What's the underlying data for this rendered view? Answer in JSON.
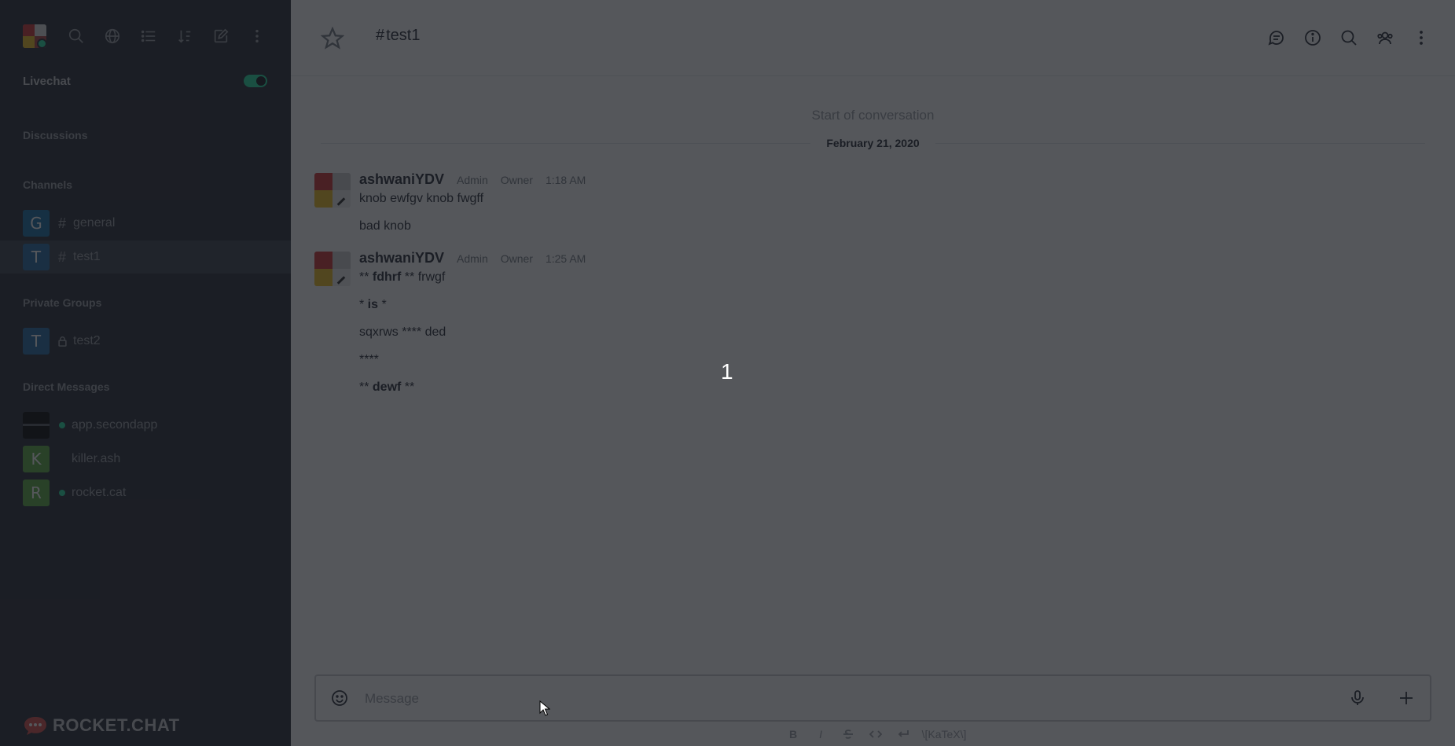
{
  "sidebar": {
    "livechat_label": "Livechat",
    "livechat_enabled": true,
    "sections": {
      "discussions": "Discussions",
      "channels": "Channels",
      "private_groups": "Private Groups",
      "direct_messages": "Direct Messages"
    },
    "channels": [
      {
        "initial": "G",
        "name": "general",
        "color": "#1d74a8"
      },
      {
        "initial": "T",
        "name": "test1",
        "color": "#2d6fa8"
      }
    ],
    "private_groups": [
      {
        "initial": "T",
        "name": "test2",
        "color": "#2d6fa8"
      }
    ],
    "direct_messages": [
      {
        "name": "app.secondapp",
        "online": true
      },
      {
        "initial": "K",
        "name": "killer.ash",
        "online": false,
        "color": "#63b04a"
      },
      {
        "initial": "R",
        "name": "rocket.cat",
        "online": true,
        "color": "#63b04a"
      }
    ],
    "brand": "ROCKET.CHAT"
  },
  "header": {
    "room_name": "test1",
    "hash": "#"
  },
  "conversation": {
    "start_label": "Start of conversation",
    "date": "February 21, 2020",
    "messages": [
      {
        "user": "ashwaniYDV",
        "roles": [
          "Admin",
          "Owner"
        ],
        "time": "1:18 AM",
        "lines": [
          "knob ewfgv knob fwgff",
          "bad knob"
        ]
      },
      {
        "user": "ashwaniYDV",
        "roles": [
          "Admin",
          "Owner"
        ],
        "time": "1:25 AM",
        "lines": [
          {
            "pre": "** ",
            "bold": "fdhrf",
            "post": " ** frwgf"
          },
          {
            "pre": "* ",
            "bold": "is",
            "post": " *"
          },
          {
            "pre": "sqxrws **** ded",
            "bold": "",
            "post": ""
          },
          {
            "pre": "****",
            "bold": "",
            "post": ""
          },
          {
            "pre": "** ",
            "bold": "dewf",
            "post": " **"
          }
        ]
      }
    ]
  },
  "composer": {
    "placeholder": "Message",
    "format": {
      "bold": "B",
      "italic": "I",
      "katex": "\\[KaTeX\\]"
    }
  },
  "overlay": {
    "count": "1"
  },
  "colors": {
    "sidebar_bg": "#2f343d",
    "online": "#2de0a5"
  }
}
